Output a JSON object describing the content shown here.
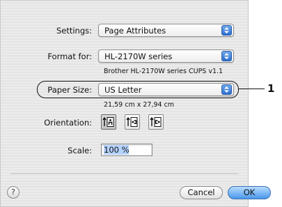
{
  "settings": {
    "label": "Settings:",
    "value": "Page Attributes"
  },
  "format_for": {
    "label": "Format for:",
    "value": "HL-2170W series",
    "note": "Brother HL-2170W series CUPS v1.1"
  },
  "paper_size": {
    "label": "Paper Size:",
    "value": "US Letter",
    "note": "21,59 cm x 27,94 cm"
  },
  "orientation": {
    "label": "Orientation:",
    "options": [
      "portrait",
      "landscape-left",
      "landscape-right"
    ],
    "selected": "portrait"
  },
  "scale": {
    "label": "Scale:",
    "value": "100 %"
  },
  "buttons": {
    "help": "?",
    "cancel": "Cancel",
    "ok": "OK"
  },
  "callout": {
    "number": "1"
  },
  "colors": {
    "accent": "#3a7fd8",
    "panel": "#ececec"
  }
}
